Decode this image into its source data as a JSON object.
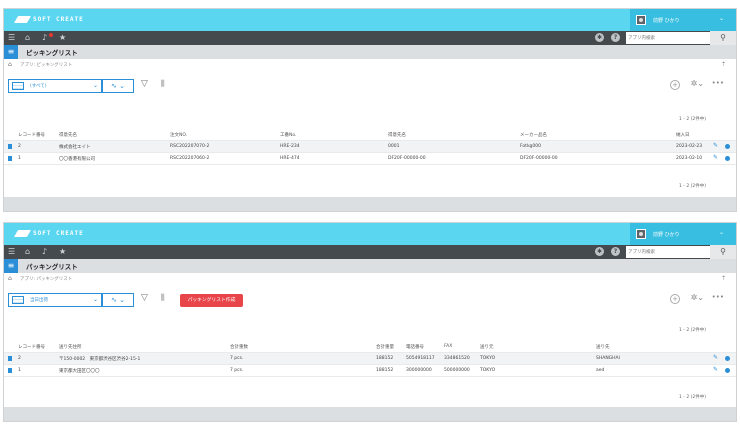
{
  "app": {
    "brand": "SOFT CREATE",
    "user": "前野 ひかり",
    "search_placeholder": "アプリ内検索"
  },
  "panels": [
    {
      "title": "ピッキングリスト",
      "breadcrumb": "アプリ: ピッキングリスト",
      "view": "(すべて)",
      "count": "1 - 2 (2件中)",
      "columns": [
        "レコード番号",
        "得意先名",
        "注文NO.",
        "工番No.",
        "得意先名",
        "メーカー品名",
        "納入日"
      ],
      "rows": [
        [
          "2",
          "株式会社エイト",
          "RSC202207070-2",
          "HRE-234",
          "0001",
          "Fotkg000",
          "2023-02-23"
        ],
        [
          "1",
          "〇〇香港有限公司",
          "RSC202207060-2",
          "HRE-474",
          "DF20F-00000-00",
          "DF20F-00000-00",
          "2023-02-10"
        ]
      ]
    },
    {
      "title": "パッキングリスト",
      "breadcrumb": "アプリ: パッキングリスト",
      "view": "当日出荷",
      "action_button": "パッキングリスト作成",
      "count": "1 - 2 (2件中)",
      "columns": [
        "レコード番号",
        "送り先住所",
        "合計重数",
        "合計重量",
        "電話番号",
        "FAX",
        "送り元",
        "送り先"
      ],
      "rows": [
        [
          "2",
          "〒150-0002　東京都渋谷区渋谷2-15-1",
          "7 pcs.",
          "188152",
          "5054918117",
          "334861520",
          "TOKYO",
          "SHANGHAI"
        ],
        [
          "1",
          "東京都大田区〇〇〇",
          "7 pcs.",
          "188152",
          "300000000",
          "500000000",
          "TOKYO",
          "aed"
        ]
      ]
    }
  ]
}
